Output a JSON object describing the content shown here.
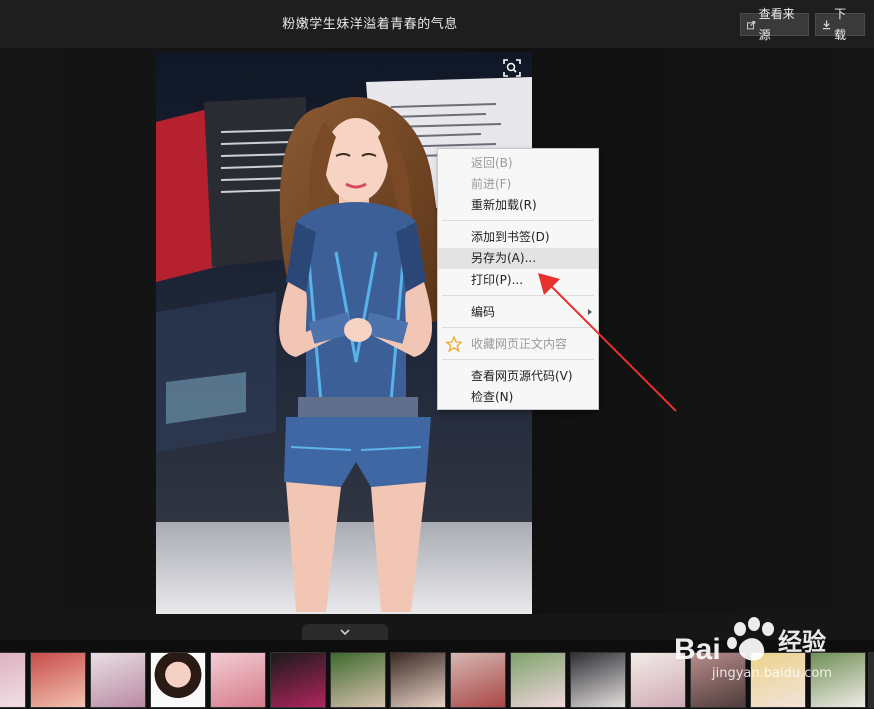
{
  "header": {
    "title": "粉嫩学生妹洋溢着青春的气息",
    "view_source_label": "查看来源",
    "download_label": "下载"
  },
  "context_menu": {
    "items": [
      {
        "label": "返回(B)",
        "state": "disabled"
      },
      {
        "label": "前进(F)",
        "state": "disabled"
      },
      {
        "label": "重新加载(R)",
        "state": "enabled"
      },
      {
        "label": "添加到书签(D)",
        "state": "enabled"
      },
      {
        "label": "另存为(A)...",
        "state": "hover"
      },
      {
        "label": "打印(P)...",
        "state": "enabled"
      },
      {
        "label": "编码",
        "state": "submenu"
      },
      {
        "label": "收藏网页正文内容",
        "state": "disabled"
      },
      {
        "label": "查看网页源代码(V)",
        "state": "enabled"
      },
      {
        "label": "检查(N)",
        "state": "enabled"
      }
    ]
  },
  "watermark": {
    "brand": "Bai",
    "brand_cn": "经验",
    "url": "jingyan.baidu.com"
  },
  "colors": {
    "arrow": "#e8312f",
    "menu_bg": "#f7f7f7",
    "header_bg": "#1e1e1e"
  }
}
